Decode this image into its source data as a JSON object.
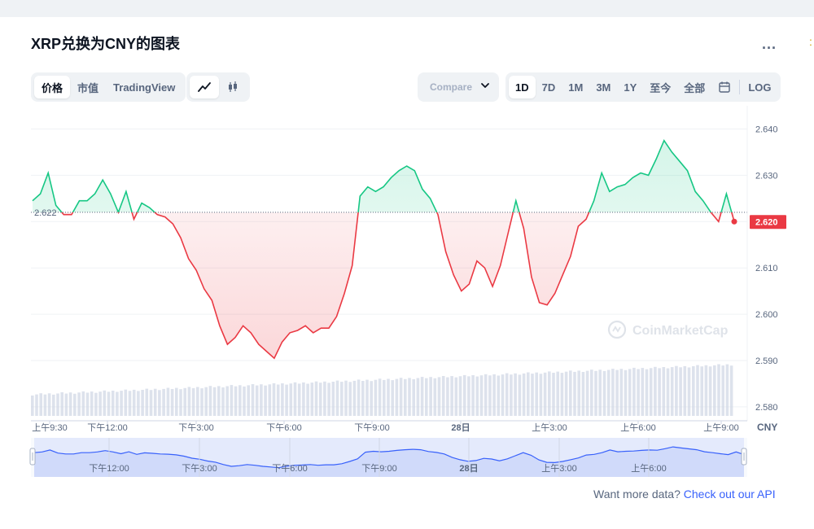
{
  "title": "XRP兑换为CNY的图表",
  "more_label": "...",
  "view_tabs": [
    {
      "label": "价格",
      "active": true
    },
    {
      "label": "市值",
      "active": false
    },
    {
      "label": "TradingView",
      "active": false
    }
  ],
  "chart_type_icons": [
    "line-chart-icon",
    "candlestick-icon"
  ],
  "compare_label": "Compare",
  "range_tabs": [
    {
      "label": "1D",
      "active": true
    },
    {
      "label": "7D",
      "active": false
    },
    {
      "label": "1M",
      "active": false
    },
    {
      "label": "3M",
      "active": false
    },
    {
      "label": "1Y",
      "active": false
    },
    {
      "label": "至今",
      "active": false
    },
    {
      "label": "全部",
      "active": false
    }
  ],
  "log_label": "LOG",
  "footer": {
    "text": "Want more data?",
    "link": "Check out our API"
  },
  "watermark": "CoinMarketCap",
  "colors": {
    "up": "#16c784",
    "down": "#ea3943",
    "accent": "#3861fb",
    "navigator": "#dde4fb"
  },
  "chart_data": {
    "type": "area",
    "currency_label": "CNY",
    "ylim": [
      2.577,
      2.645
    ],
    "y_ticks": [
      "2.640",
      "2.630",
      "2.620",
      "2.610",
      "2.600",
      "2.590",
      "2.580"
    ],
    "x_ticks": [
      "上午9:30",
      "下午12:00",
      "下午3:00",
      "下午6:00",
      "下午9:00",
      "28日",
      "上午3:00",
      "上午6:00",
      "上午9:00"
    ],
    "navigator_ticks": [
      "下午12:00",
      "下午3:00",
      "下午6:00",
      "下午9:00",
      "28日",
      "上午3:00",
      "上午6:00"
    ],
    "open_price": 2.622,
    "open_label": "2.622",
    "last_price": 2.62,
    "last_label": "2.620",
    "x": [
      0,
      10,
      20,
      30,
      40,
      50,
      60,
      70,
      80,
      90,
      100,
      110,
      120,
      130,
      140,
      150,
      160,
      170,
      180,
      190,
      200,
      210,
      220,
      230,
      240,
      250,
      260,
      270,
      280,
      290,
      300,
      310,
      320,
      330,
      340,
      350,
      360,
      370,
      380,
      390,
      400,
      410,
      420,
      430,
      440,
      450,
      460,
      470,
      480,
      490,
      500,
      510,
      520,
      530,
      540,
      550,
      560,
      570,
      580,
      590,
      600,
      610,
      620,
      630,
      640,
      650,
      660,
      670,
      680,
      690,
      700,
      710,
      720,
      730,
      740,
      750,
      760,
      770,
      780,
      790,
      800,
      810,
      820,
      830,
      840,
      850,
      860,
      870,
      880,
      890,
      900
    ],
    "values": [
      2.6245,
      2.626,
      2.6305,
      2.6235,
      2.6215,
      2.6215,
      2.6245,
      2.6245,
      2.626,
      2.629,
      2.626,
      2.622,
      2.6265,
      2.6205,
      2.624,
      2.623,
      2.6215,
      2.621,
      2.6195,
      2.6165,
      2.612,
      2.6095,
      2.6055,
      2.603,
      2.5975,
      2.5935,
      2.595,
      2.5975,
      2.596,
      2.5935,
      2.592,
      2.5905,
      2.594,
      2.596,
      2.5965,
      2.5975,
      2.596,
      2.597,
      2.597,
      2.5995,
      2.6045,
      2.6105,
      2.6255,
      2.6275,
      2.6265,
      2.6275,
      2.6295,
      2.631,
      2.632,
      2.631,
      2.627,
      2.625,
      2.6215,
      2.6135,
      2.6085,
      2.605,
      2.6065,
      2.6115,
      2.61,
      2.606,
      2.6105,
      2.6175,
      2.6245,
      2.6185,
      2.608,
      2.6025,
      2.602,
      2.6045,
      2.6085,
      2.6125,
      2.619,
      2.6205,
      2.6245,
      2.6305,
      2.6265,
      2.6275,
      2.628,
      2.6295,
      2.6305,
      2.63,
      2.6335,
      2.6375,
      2.635,
      2.633,
      2.631,
      2.6265,
      2.6245,
      2.622,
      2.62,
      2.626,
      2.62
    ],
    "volume_note": "volume bars rising gradually"
  }
}
